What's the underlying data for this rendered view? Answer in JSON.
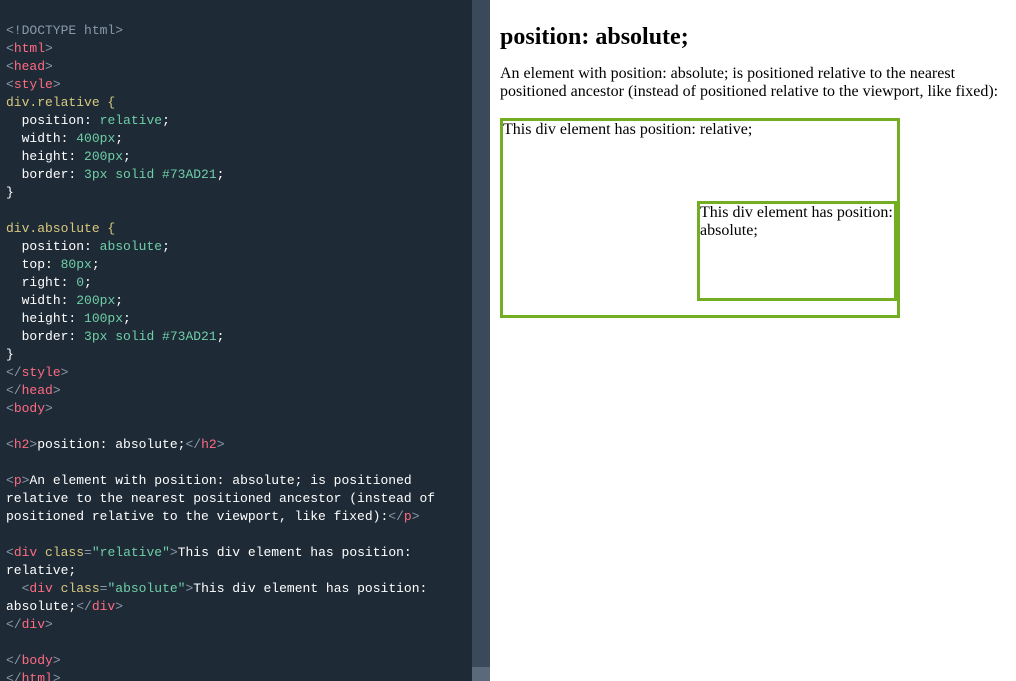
{
  "code": {
    "doctype": "<!DOCTYPE html>",
    "html_open": "html",
    "head_open": "head",
    "style_open": "style",
    "sel_rel": "div.relative {",
    "rel_p1k": "position",
    "rel_p1v": "relative",
    "rel_p2k": "width",
    "rel_p2v": "400px",
    "rel_p3k": "height",
    "rel_p3v": "200px",
    "rel_p4k": "border",
    "rel_p4v": "3px solid #73AD21",
    "sel_abs": "div.absolute {",
    "abs_p1k": "position",
    "abs_p1v": "absolute",
    "abs_p2k": "top",
    "abs_p2v": "80px",
    "abs_p3k": "right",
    "abs_p3v": "0",
    "abs_p4k": "width",
    "abs_p4v": "200px",
    "abs_p5k": "height",
    "abs_p5v": "100px",
    "abs_p6k": "border",
    "abs_p6v": "3px solid #73AD21",
    "close_brace": "}",
    "style_close": "style",
    "head_close": "head",
    "body_open": "body",
    "h2_tag": "h2",
    "h2_text": "position: absolute;",
    "p_tag": "p",
    "p_text1": "An element with position: absolute; is positioned",
    "p_text2": "relative to the nearest positioned ancestor (instead of",
    "p_text3": "positioned relative to the viewport, like fixed):",
    "div_tag": "div",
    "class_attr": "class",
    "class_rel": "\"relative\"",
    "class_abs": "\"absolute\"",
    "div_rel_text1": "This div element has position:",
    "div_rel_text2": "relative;",
    "div_abs_text1": "This div element has position:",
    "div_abs_text2": "absolute;",
    "body_close": "body",
    "html_close": "html"
  },
  "preview": {
    "heading": "position: absolute;",
    "paragraph": "An element with position: absolute; is positioned relative to the nearest positioned ancestor (instead of positioned relative to the viewport, like fixed):",
    "relative_text": "This div element has position: relative;",
    "absolute_text": "This div element has position: absolute;"
  }
}
